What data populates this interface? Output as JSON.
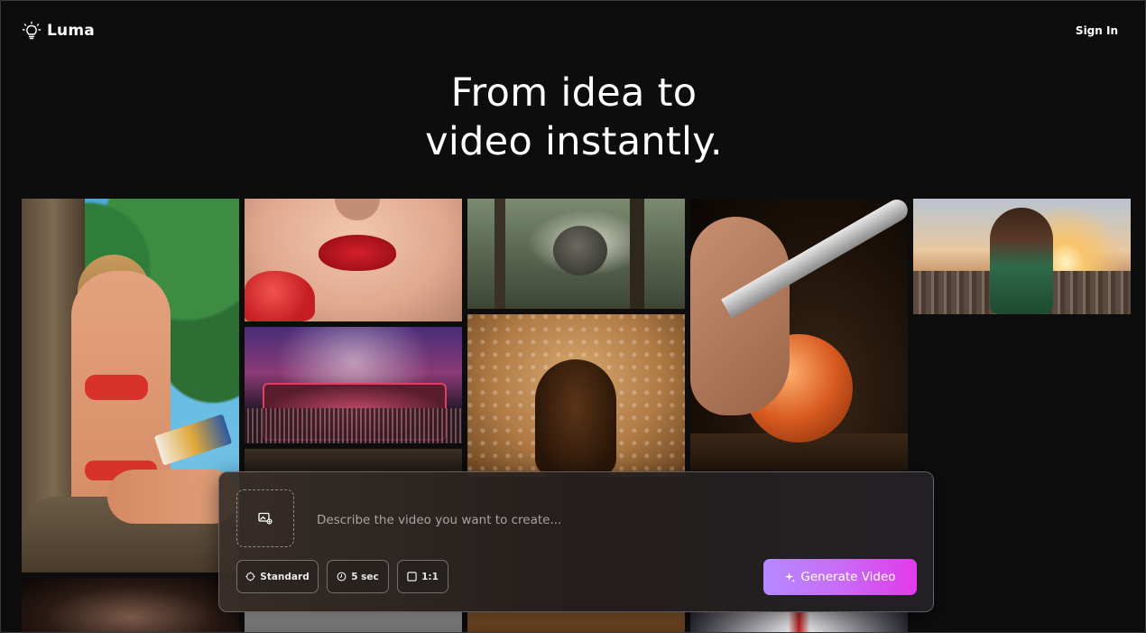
{
  "header": {
    "brand": "Luma",
    "sign_in": "Sign In"
  },
  "hero": {
    "line1": "From idea to",
    "line2": "video instantly."
  },
  "prompt": {
    "placeholder": "Describe the video you want to create...",
    "value": ""
  },
  "options": {
    "quality": "Standard",
    "duration": "5 sec",
    "ratio": "1:1"
  },
  "generate": {
    "label": "Generate Video",
    "gradient": [
      "#b58aff",
      "#c86cf8",
      "#e23ae8"
    ]
  },
  "icons": {
    "logo": "lightbulb-icon",
    "upload": "image-upload-icon",
    "quality": "sparkle-circle-icon",
    "duration": "clock-icon",
    "ratio": "square-icon",
    "generate": "sparkles-icon"
  },
  "colors": {
    "background": "#0d0d0d",
    "text": "#ffffff"
  }
}
